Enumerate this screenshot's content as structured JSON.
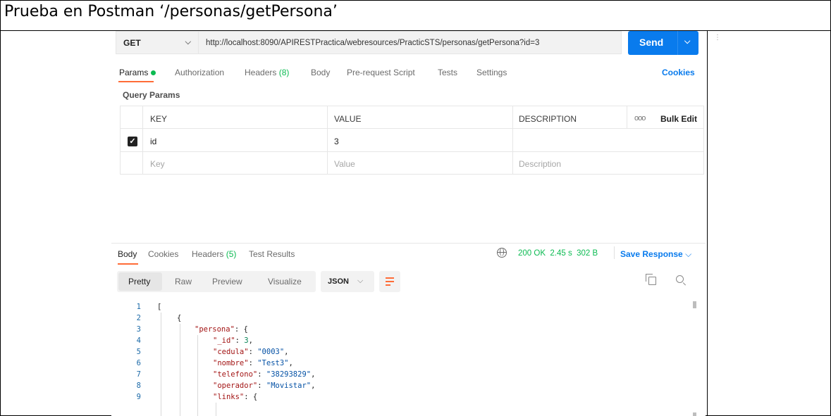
{
  "caption": "Prueba en Postman ‘/personas/getPersona’",
  "request": {
    "method": "GET",
    "url": "http://localhost:8090/APIRESTPractica/webresources/PracticSTS/personas/getPersona?id=3",
    "send_label": "Send"
  },
  "tabs": {
    "params": "Params",
    "authorization": "Authorization",
    "headers": "Headers",
    "headers_count": "(8)",
    "body": "Body",
    "prerequest": "Pre-request Script",
    "tests": "Tests",
    "settings": "Settings",
    "cookies": "Cookies"
  },
  "query_params": {
    "title": "Query Params",
    "columns": {
      "key": "KEY",
      "value": "VALUE",
      "description": "DESCRIPTION"
    },
    "bulk_edit": "Bulk Edit",
    "rows": [
      {
        "checked": true,
        "key": "id",
        "value": "3",
        "description": ""
      }
    ],
    "placeholder": {
      "key": "Key",
      "value": "Value",
      "description": "Description"
    }
  },
  "response": {
    "tabs": {
      "body": "Body",
      "cookies": "Cookies",
      "headers": "Headers",
      "headers_count": "(5)",
      "test_results": "Test Results"
    },
    "status": "200 OK",
    "time": "2.45 s",
    "size": "302 B",
    "save_label": "Save Response",
    "views": {
      "pretty": "Pretty",
      "raw": "Raw",
      "preview": "Preview",
      "visualize": "Visualize"
    },
    "format": "JSON",
    "line_numbers": [
      "1",
      "2",
      "3",
      "4",
      "5",
      "6",
      "7",
      "8",
      "9"
    ],
    "code": {
      "l1": "[",
      "l2": "{",
      "l3_key": "\"persona\"",
      "l3_rest": ": {",
      "l4_key": "\"_id\"",
      "l4_val": "3",
      "l5_key": "\"cedula\"",
      "l5_val": "\"0003\"",
      "l6_key": "\"nombre\"",
      "l6_val": "\"Test3\"",
      "l7_key": "\"telefono\"",
      "l7_val": "\"38293829\"",
      "l8_key": "\"operador\"",
      "l8_val": "\"Movistar\"",
      "l9_key": "\"links\"",
      "l9_rest": ": {"
    }
  },
  "colors": {
    "accent_blue": "#097bed",
    "accent_orange": "#ff6c37",
    "ok_green": "#0cbb52"
  },
  "icons": [
    "chevron-down-icon",
    "checkbox-checked-icon",
    "more-icon",
    "globe-icon",
    "wrap-lines-icon",
    "copy-icon",
    "search-icon"
  ]
}
